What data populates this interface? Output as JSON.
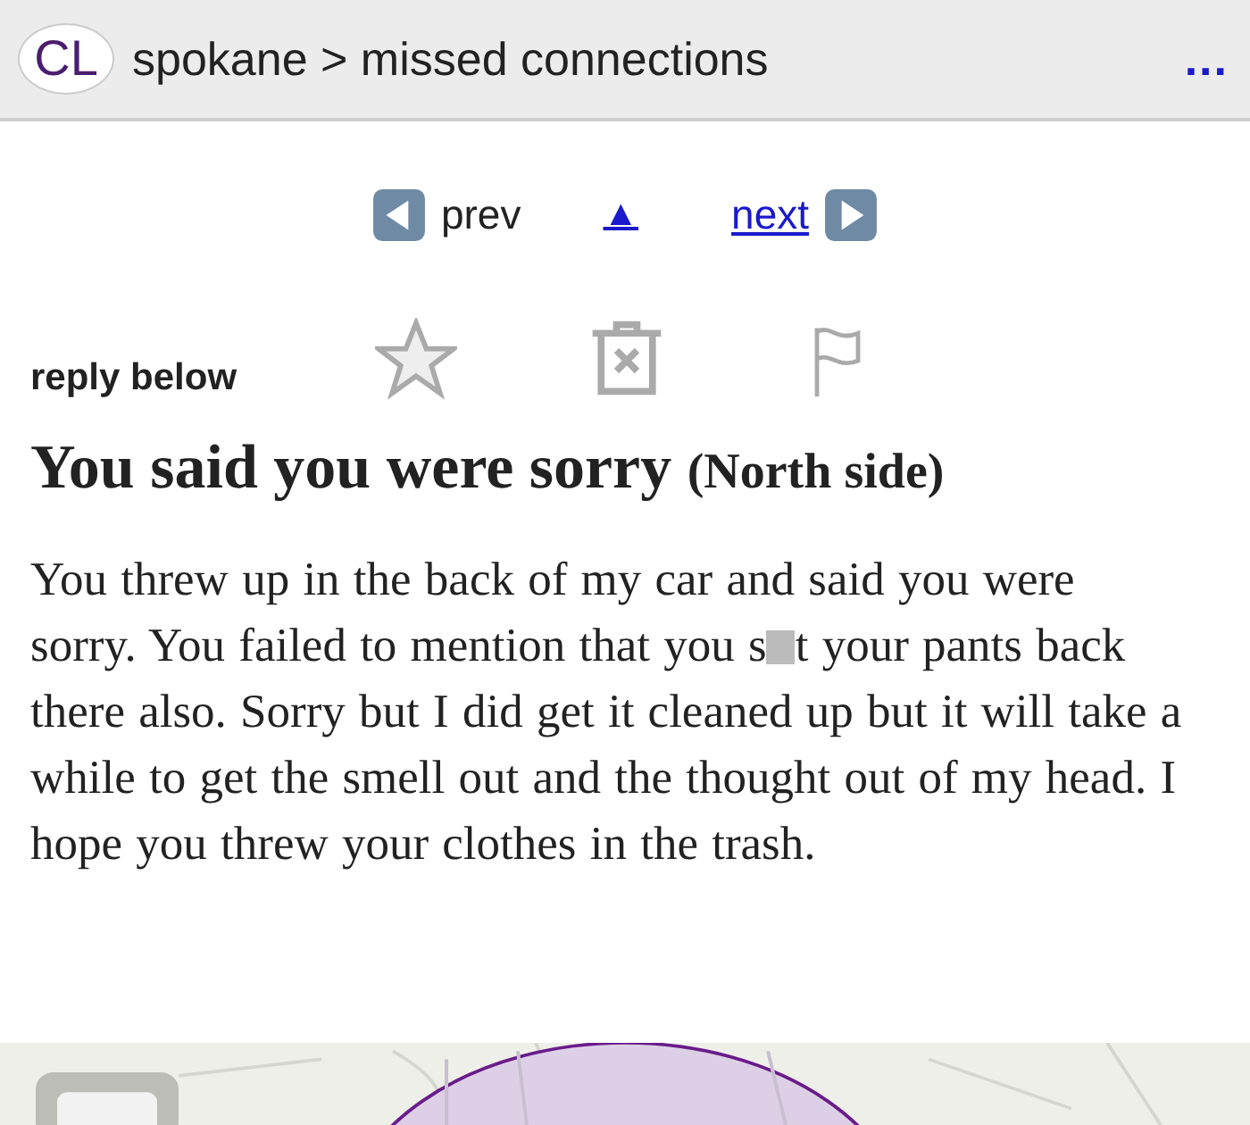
{
  "header": {
    "logo": "CL",
    "breadcrumb": "spokane > missed connections",
    "menu": "..."
  },
  "nav": {
    "prev": "prev",
    "up": "▲",
    "next": "next"
  },
  "reply_label": "reply below",
  "posting": {
    "title": "You said you were sorry",
    "location": "(North side)"
  },
  "body": {
    "before": "You threw up in the back of my car and said you were sorry. You failed to mention that you s",
    "after": "t your pants back there also. Sorry but I did get it cleaned up but it will take a while to get the smell out and the thought out of my head. I hope you threw your clothes in the trash."
  }
}
